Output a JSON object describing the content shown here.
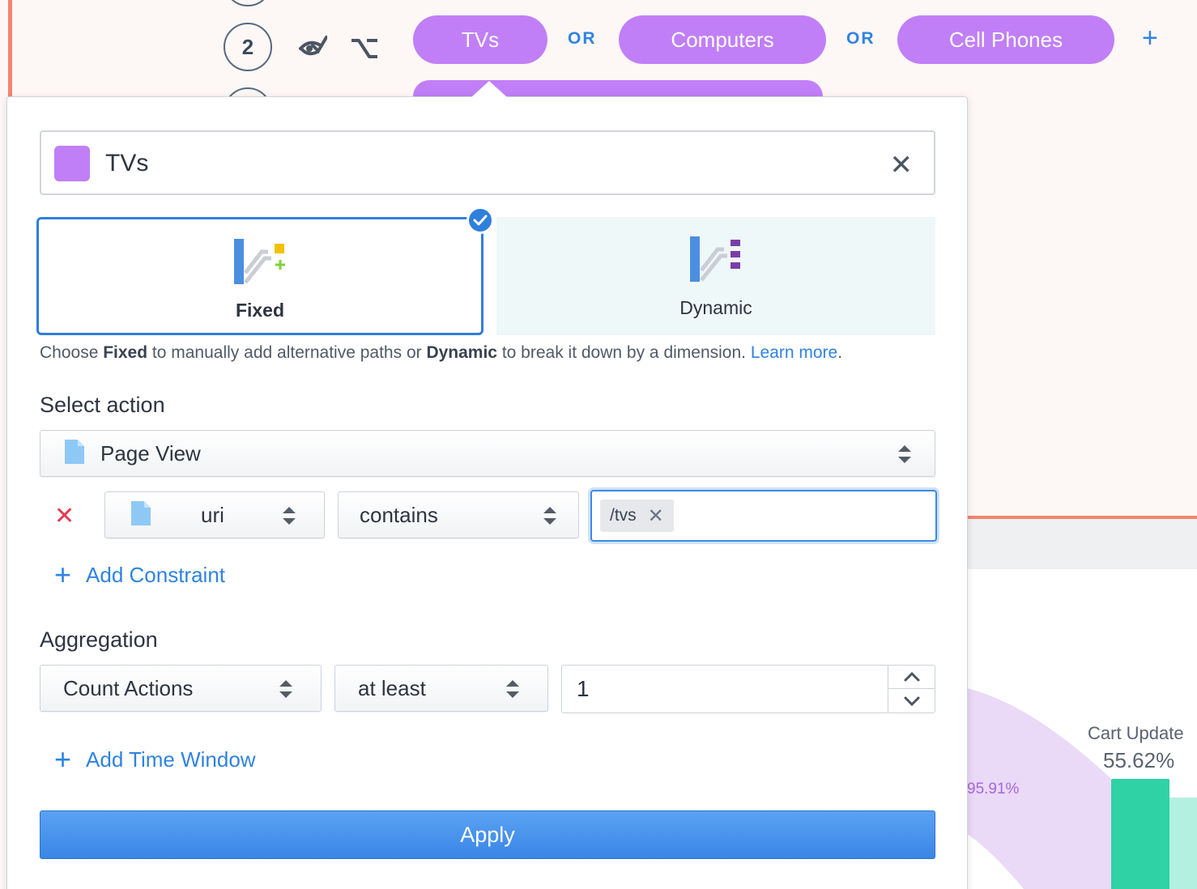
{
  "funnel": {
    "step_number": "2",
    "paths": [
      {
        "label": "TVs"
      },
      {
        "label": "Computers"
      },
      {
        "label": "Cell Phones"
      }
    ],
    "or_label": "OR",
    "add_icon": "plus-icon",
    "accent_color": "#c17ff7"
  },
  "popover": {
    "name_value": "TVs",
    "swatch_color": "#c17ff7",
    "modes": {
      "fixed_label": "Fixed",
      "dynamic_label": "Dynamic",
      "selected": "Fixed"
    },
    "help": {
      "prefix": "Choose ",
      "fixed": "Fixed",
      "middle": " to manually add alternative paths or ",
      "dynamic": "Dynamic",
      "suffix": " to break it down by a dimension. ",
      "link": "Learn more",
      "end": "."
    },
    "select_action": {
      "title": "Select action",
      "value": "Page View"
    },
    "constraint": {
      "property": "uri",
      "operator": "contains",
      "token": "/tvs"
    },
    "add_constraint_label": "Add Constraint",
    "aggregation": {
      "title": "Aggregation",
      "function": "Count Actions",
      "comparator": "at least",
      "value": "1"
    },
    "add_time_window_label": "Add Time Window",
    "apply_label": "Apply"
  },
  "background": {
    "flow_percent": "95.91%",
    "cart_label": "Cart Update",
    "cart_percent": "55.62%",
    "bar_color": "#2ed2a4"
  }
}
